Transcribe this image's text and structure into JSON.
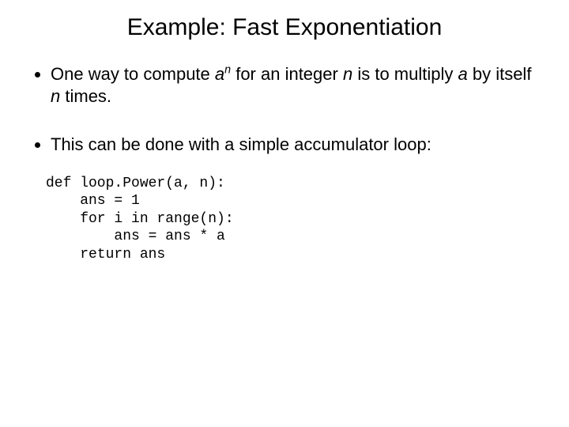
{
  "title": "Example: Fast Exponentiation",
  "bullets": {
    "b1": {
      "part1": "One way to compute ",
      "base": "a",
      "exp": "n",
      "part2": " for an integer ",
      "n": "n",
      "part3": " is to multiply ",
      "a": "a",
      "part4": " by itself ",
      "n2": "n",
      "part5": " times."
    },
    "b2": "This can be done with a simple accumulator loop:"
  },
  "code": "def loop.Power(a, n):\n    ans = 1\n    for i in range(n):\n        ans = ans * a\n    return ans"
}
